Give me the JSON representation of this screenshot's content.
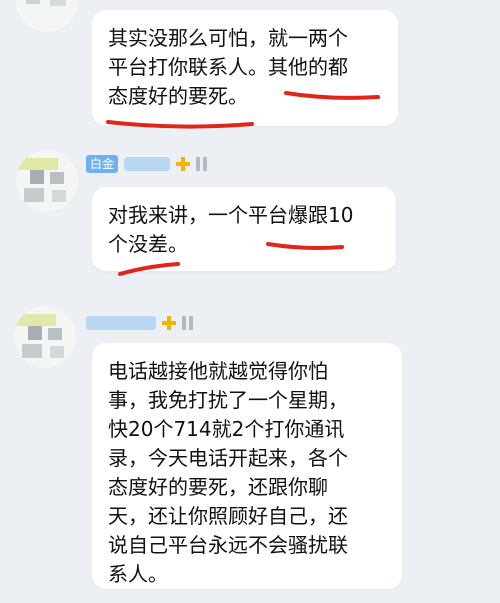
{
  "messages": [
    {
      "nickname": "",
      "lines": [
        "其实没那么可怕，就一两个",
        "平台打你联系人。其他的都",
        "态度好的要死。"
      ]
    },
    {
      "nickname_tag": "白金",
      "lines": [
        "对我来讲，一个平台爆跟10",
        "个没差。"
      ]
    },
    {
      "nickname": "",
      "lines": [
        "电话越接他就越觉得你怕",
        "事，我免打扰了一个星期，",
        "快20个714就2个打你通讯",
        "录，今天电话开起来，各个",
        "态度好的要死，还跟你聊",
        "天，还让你照顾好自己，还",
        "说自己平台永远不会骚扰联",
        "系人。"
      ]
    }
  ],
  "colors": {
    "background": "#eceff3",
    "bubble": "#ffffff",
    "underline": "#e0251b",
    "tag": "#6fb0f0"
  }
}
